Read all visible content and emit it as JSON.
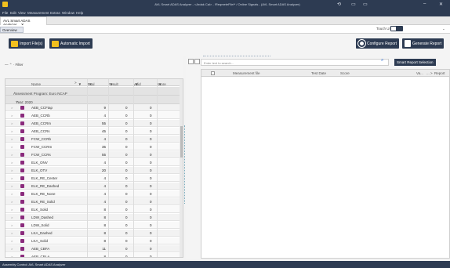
{
  "window": {
    "title": "AVL Smart ADAS Analyzer - <Ardak Cal> - !ReqmeteFile!* / Online Signals - (AVL Smart ADAS Analyzer)",
    "controls": {
      "minimize": "–",
      "close": "✕"
    }
  },
  "menu": [
    "File",
    "Edit",
    "View",
    "Measurement",
    "Extras",
    "Window",
    "Help"
  ],
  "document_tab": {
    "label": "AVL Smart ADAS Analyzer"
  },
  "subtabs": {
    "overview": "Overview",
    "touch_ui": "Touch UI"
  },
  "toolbar": {
    "import_files": "Import File(s)",
    "automatic_import": "Automatic Import",
    "configure_report": "Configure Report",
    "generate_report": "Generate Report"
  },
  "left": {
    "filter_label": "Filter",
    "columns": {
      "name": "Name",
      "total": "Total",
      "result": "Result",
      "valid": "Valid",
      "score": "Score"
    },
    "group_program": "Assessment Program: Euro NCAP",
    "group_year": "Year: 2020",
    "rows": [
      {
        "name": "AEB_CCFtap",
        "total": "9",
        "result": "0",
        "valid": "0"
      },
      {
        "name": "AEB_CCRb",
        "total": "4",
        "result": "0",
        "valid": "0"
      },
      {
        "name": "AEB_CCRm",
        "total": "55",
        "result": "0",
        "valid": "0"
      },
      {
        "name": "AEB_CCRs",
        "total": "45",
        "result": "0",
        "valid": "0"
      },
      {
        "name": "FCW_CCRb",
        "total": "4",
        "result": "0",
        "valid": "0"
      },
      {
        "name": "FCW_CCRm",
        "total": "35",
        "result": "0",
        "valid": "0"
      },
      {
        "name": "FCW_CCRs",
        "total": "55",
        "result": "0",
        "valid": "0"
      },
      {
        "name": "ELK_ONV",
        "total": "4",
        "result": "0",
        "valid": "0"
      },
      {
        "name": "ELK_OTV",
        "total": "20",
        "result": "0",
        "valid": "0"
      },
      {
        "name": "ELK_RE_Center",
        "total": "4",
        "result": "0",
        "valid": "0"
      },
      {
        "name": "ELK_RE_Dashed",
        "total": "4",
        "result": "0",
        "valid": "0"
      },
      {
        "name": "ELK_RE_None",
        "total": "4",
        "result": "0",
        "valid": "0"
      },
      {
        "name": "ELK_RE_Solid",
        "total": "4",
        "result": "0",
        "valid": "0"
      },
      {
        "name": "ELK_Solid",
        "total": "8",
        "result": "0",
        "valid": "0"
      },
      {
        "name": "LDW_Dashed",
        "total": "8",
        "result": "0",
        "valid": "0"
      },
      {
        "name": "LDW_Solid",
        "total": "8",
        "result": "0",
        "valid": "0"
      },
      {
        "name": "LKA_Dashed",
        "total": "8",
        "result": "0",
        "valid": "0"
      },
      {
        "name": "LKA_Solid",
        "total": "8",
        "result": "0",
        "valid": "0"
      },
      {
        "name": "AEB_CBFA",
        "total": "11",
        "result": "0",
        "valid": "0"
      },
      {
        "name": "AEB_CBLA",
        "total": "8",
        "result": "0",
        "valid": "0"
      }
    ]
  },
  "right": {
    "search_placeholder": "Enter text to search...",
    "smart_report_selection": "Smart Report Selection",
    "columns": {
      "measurement_file": "Measurement file",
      "test_date": "Test Date",
      "score": "Score",
      "va": "Va...",
      "report": "Report"
    }
  },
  "status": {
    "text": "Assembly Control: AVL Smart ADAS Analyzer"
  }
}
